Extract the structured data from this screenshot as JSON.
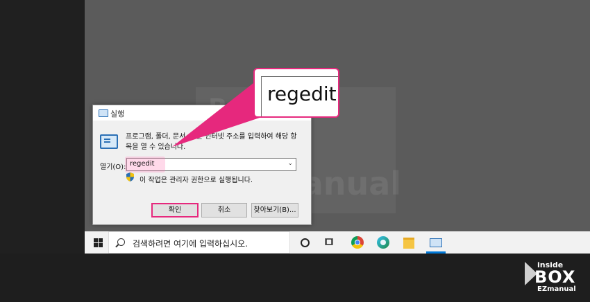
{
  "dialog": {
    "title": "실행",
    "description": "프로그램, 폴더, 문서, 또는 인터넷 주소를 입력하여 해당 항목을 열 수 있습니다.",
    "open_label": "열기(O):",
    "input_value": "regedit",
    "admin_notice": "이 작업은 관리자 권한으로 실행됩니다.",
    "ok_label": "확인",
    "cancel_label": "취소",
    "browse_label": "찾아보기(B)..."
  },
  "taskbar": {
    "search_placeholder": "검색하려면 여기에 입력하십시오.",
    "icons": [
      "windows-start-icon",
      "search-icon",
      "cortana-icon",
      "task-view-icon",
      "chrome-icon",
      "edge-icon",
      "file-explorer-icon",
      "run-icon"
    ]
  },
  "callout": {
    "text": "regedit",
    "accent_color": "#e6287d"
  },
  "watermark": {
    "brand_top": "BOX",
    "brand_bottom": "EZmanual"
  },
  "logo": {
    "line1": "inside",
    "line2": "BOX",
    "line3": "EZmanual"
  },
  "colors": {
    "accent": "#e6287d",
    "desktop": "#5b5b5b",
    "taskbar": "#f2f2f2",
    "active_indicator": "#0078d7"
  }
}
